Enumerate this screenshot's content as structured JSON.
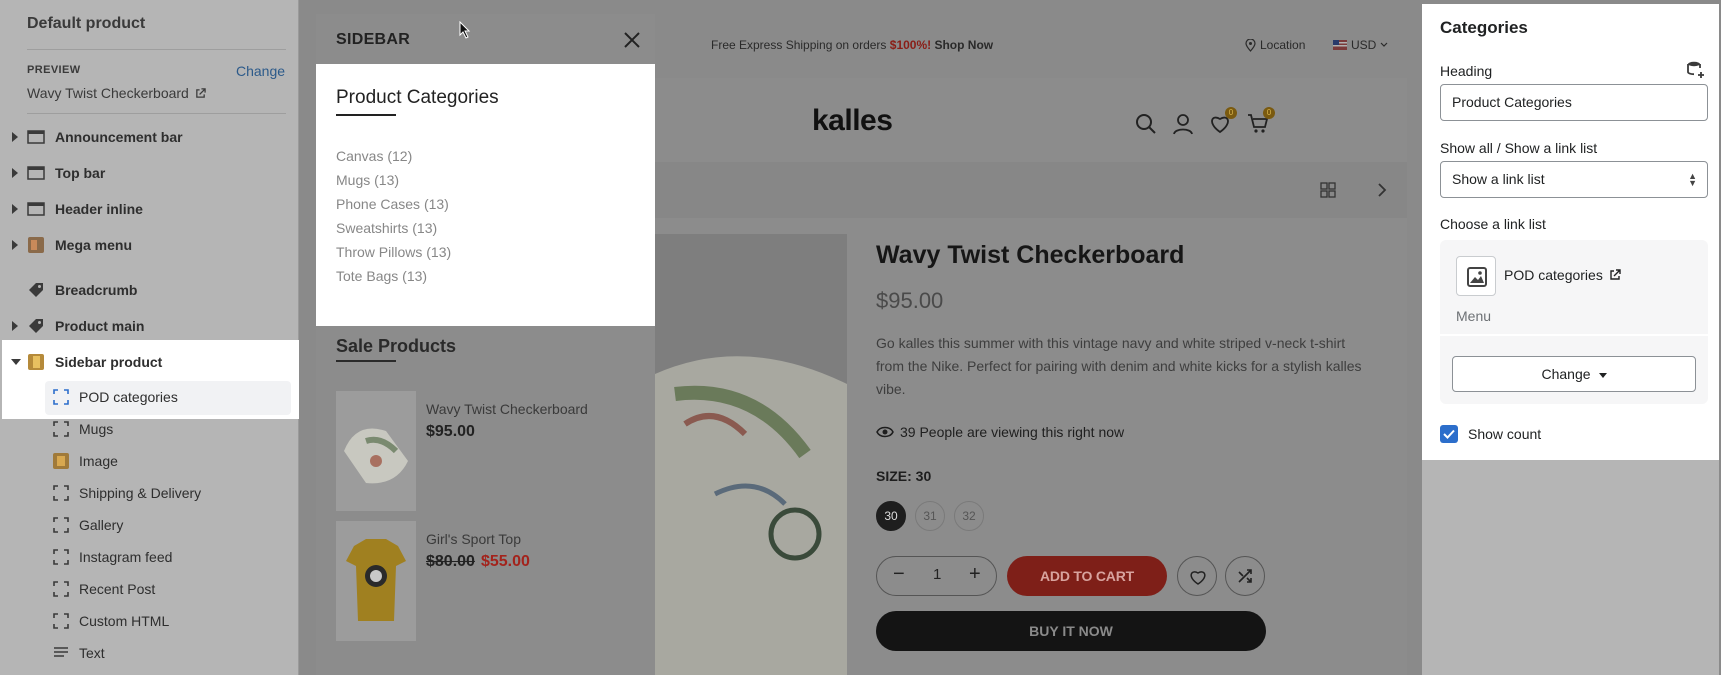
{
  "left_panel": {
    "title": "Default product",
    "preview_label": "PREVIEW",
    "change_label": "Change",
    "preview_value": "Wavy Twist Checkerboard",
    "sections": [
      {
        "label": "Announcement bar",
        "icon": "section-layout-icon"
      },
      {
        "label": "Top bar",
        "icon": "section-layout-icon"
      },
      {
        "label": "Header inline",
        "icon": "section-layout-icon"
      },
      {
        "label": "Mega menu",
        "icon": "mega-menu-thumb-icon"
      },
      {
        "label": "Breadcrumb",
        "icon": "tag-icon"
      },
      {
        "label": "Product main",
        "icon": "tag-icon"
      },
      {
        "label": "Sidebar product",
        "icon": "sidebar-product-thumb-icon"
      }
    ],
    "blocks": [
      {
        "label": "POD categories",
        "icon": "block-frame-icon"
      },
      {
        "label": "Mugs",
        "icon": "block-frame-icon"
      },
      {
        "label": "Image",
        "icon": "image-thumb-icon"
      },
      {
        "label": "Shipping & Delivery",
        "icon": "block-frame-icon"
      },
      {
        "label": "Gallery",
        "icon": "block-frame-icon"
      },
      {
        "label": "Instagram feed",
        "icon": "block-frame-icon"
      },
      {
        "label": "Recent Post",
        "icon": "block-frame-icon"
      },
      {
        "label": "Custom HTML",
        "icon": "block-frame-icon"
      },
      {
        "label": "Text",
        "icon": "text-lines-icon"
      }
    ]
  },
  "drawer": {
    "title": "SIDEBAR",
    "categories_heading": "Product Categories",
    "categories": [
      "Canvas (12)",
      "Mugs (13)",
      "Phone Cases (13)",
      "Sweatshirts (13)",
      "Throw Pillows (13)",
      "Tote Bags (13)"
    ],
    "sale_heading": "Sale Products",
    "sale_products": [
      {
        "name": "Wavy Twist Checkerboard",
        "price": "$95.00",
        "old_price": "",
        "new_price": ""
      },
      {
        "name": "Girl's Sport Top",
        "price": "",
        "old_price": "$80.00",
        "new_price": "$55.00"
      }
    ]
  },
  "store": {
    "promo_prefix": "Free Express Shipping on orders ",
    "promo_highlight": "$100%!",
    "promo_link": " Shop Now",
    "location": "Location",
    "currency": "USD",
    "logo": "kalles",
    "wishlist_count": "0",
    "cart_count": "0",
    "product": {
      "title": "Wavy Twist Checkerboard",
      "price": "$95.00",
      "description": "Go kalles this summer with this vintage navy and white striped v-neck t-shirt from the Nike. Perfect for pairing with denim and white kicks for a stylish kalles vibe.",
      "viewing": "39 People are viewing this right now",
      "size_label": "SIZE: 30",
      "sizes": [
        "30",
        "31",
        "32"
      ],
      "quantity": "1",
      "add_to_cart": "ADD TO CART",
      "buy_now": "BUY IT NOW"
    }
  },
  "right_panel": {
    "title": "Categories",
    "heading_label": "Heading",
    "heading_value": "Product Categories",
    "show_label": "Show all / Show a link list",
    "show_value": "Show a link list",
    "choose_label": "Choose a link list",
    "link_list_name": "POD categories",
    "link_list_type": "Menu",
    "change_button": "Change",
    "show_count_label": "Show count",
    "show_count_checked": true
  },
  "colors": {
    "accent_blue": "#2c6ecb",
    "sale_red": "#a3231c"
  }
}
